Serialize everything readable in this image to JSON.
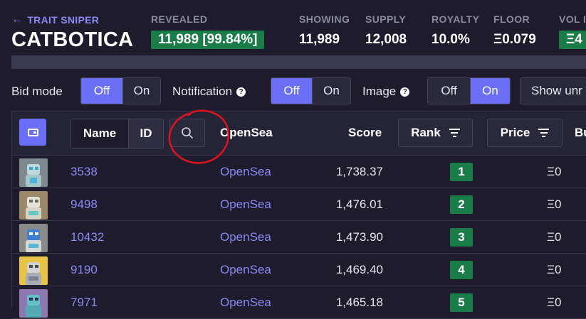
{
  "header": {
    "back_label": "TRAIT SNIPER",
    "collection_title": "CATBOTICA"
  },
  "stats": [
    {
      "label": "REVEALED",
      "value": "11,989 [99.84%]"
    },
    {
      "label": "SHOWING",
      "value": "11,989"
    },
    {
      "label": "SUPPLY",
      "value": "12,008"
    },
    {
      "label": "ROYALTY",
      "value": "10.0%"
    },
    {
      "label": "FLOOR",
      "value": "Ξ0.079"
    },
    {
      "label": "VOL I",
      "value": "Ξ4"
    }
  ],
  "controls": {
    "bid_mode": {
      "label": "Bid mode",
      "off": "Off",
      "on": "On",
      "selected": "Off"
    },
    "notification": {
      "label": "Notification",
      "off": "Off",
      "on": "On",
      "selected": "Off"
    },
    "image": {
      "label": "Image",
      "off": "Off",
      "on": "On",
      "selected": "On"
    },
    "show_unrevealed_label": "Show unr"
  },
  "table": {
    "headers": {
      "name": "Name",
      "id": "ID",
      "opensea": "OpenSea",
      "score": "Score",
      "rank": "Rank",
      "price": "Price",
      "buy": "Bu"
    },
    "rows": [
      {
        "name": "3538",
        "opensea": "OpenSea",
        "score": "1,738.37",
        "rank": "1",
        "price": "Ξ0"
      },
      {
        "name": "9498",
        "opensea": "OpenSea",
        "score": "1,476.01",
        "rank": "2",
        "price": "Ξ0"
      },
      {
        "name": "10432",
        "opensea": "OpenSea",
        "score": "1,473.90",
        "rank": "3",
        "price": "Ξ0"
      },
      {
        "name": "9190",
        "opensea": "OpenSea",
        "score": "1,469.40",
        "rank": "4",
        "price": "Ξ0"
      },
      {
        "name": "7971",
        "opensea": "OpenSea",
        "score": "1,465.18",
        "rank": "5",
        "price": "Ξ0"
      }
    ]
  },
  "colors": {
    "accent": "#6b6ff5",
    "link": "#8b8af4",
    "rank_green": "#1a7d49",
    "annotation_red": "#d9141e"
  }
}
